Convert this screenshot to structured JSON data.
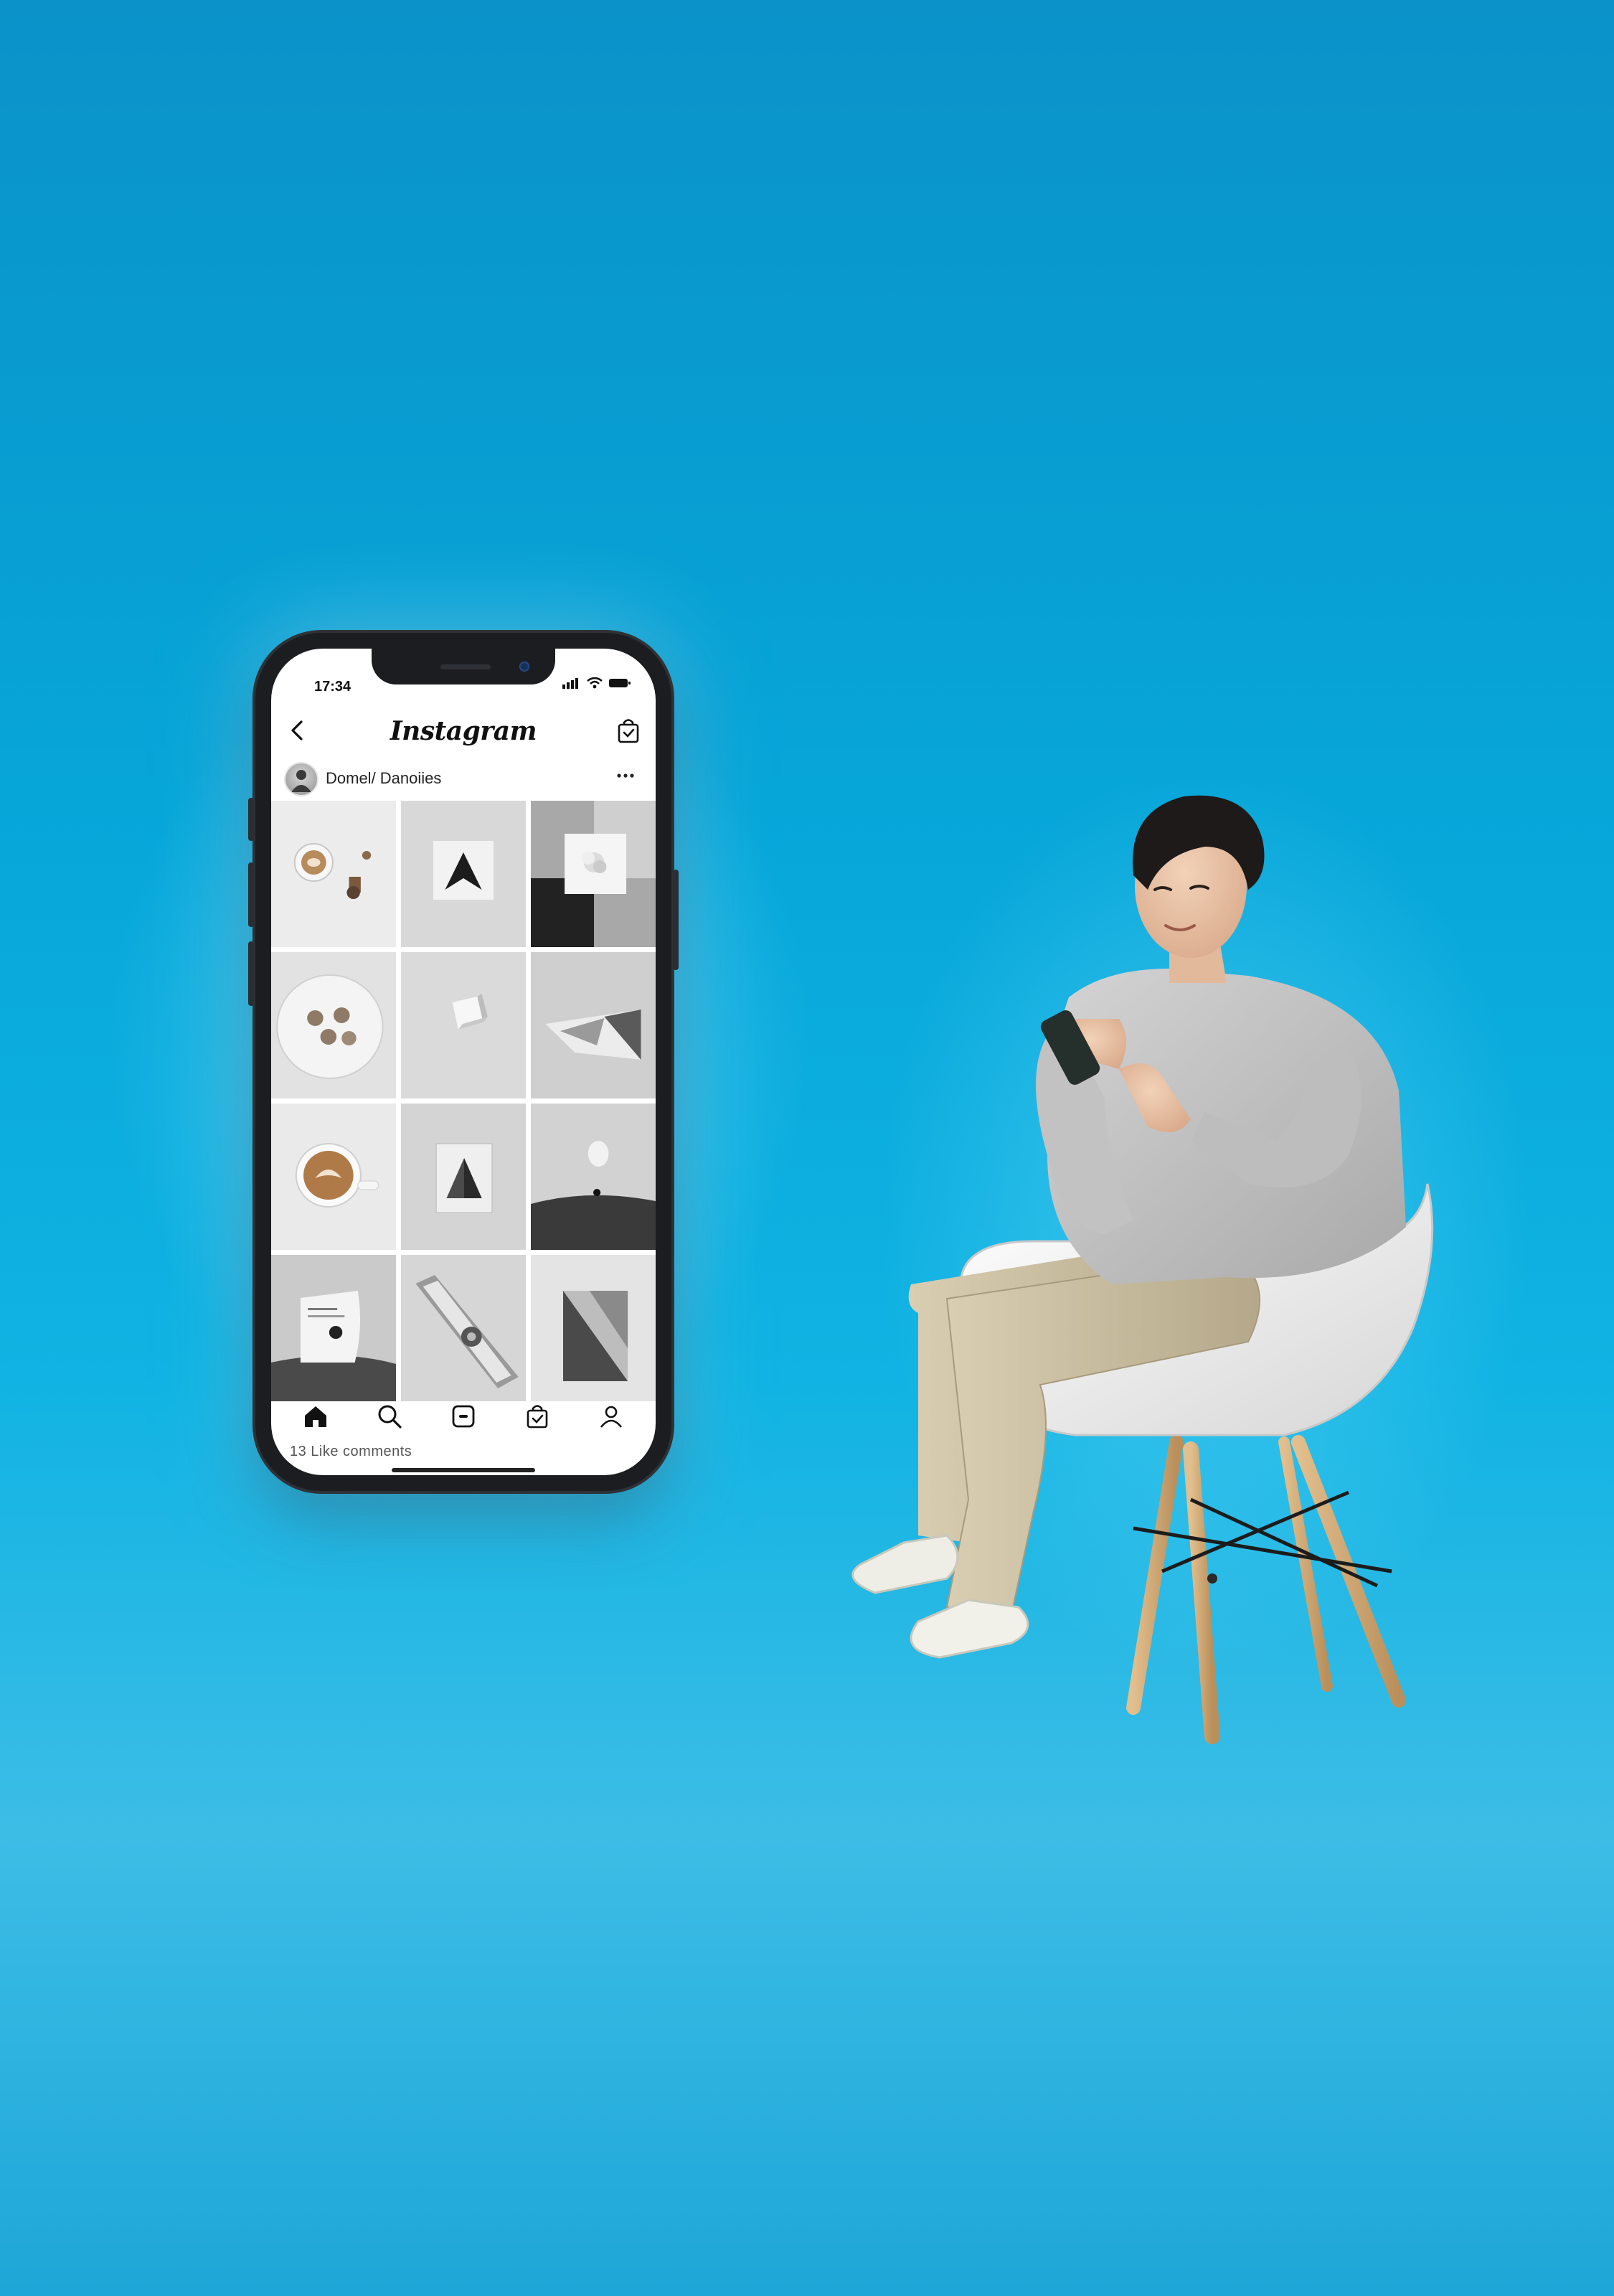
{
  "status_bar": {
    "time": "17:34"
  },
  "app": {
    "title": "Instagram"
  },
  "profile": {
    "username": "Domel/ Danoiies"
  },
  "grid_tiles": [
    "coffee-and-objects",
    "dark-triangle",
    "flowers-in-frame",
    "plate-with-shells",
    "white-cube",
    "folded-paper-sculpture",
    "latte-art-cup",
    "framed-pyramid",
    "floating-bulb-landscape",
    "curled-paper-landscape",
    "vintage-device",
    "shadow-frame"
  ],
  "tab_bar": {
    "items": [
      "home",
      "search",
      "reels",
      "shop",
      "profile"
    ],
    "active": "home"
  },
  "footer": {
    "caption": "13 Like comments"
  },
  "colors": {
    "background": "#07a6d9",
    "phone_frame": "#1b1d20",
    "sweater": "#c9c9c9",
    "pants": "#cfc2a4",
    "chair": "#f2f2f2"
  }
}
